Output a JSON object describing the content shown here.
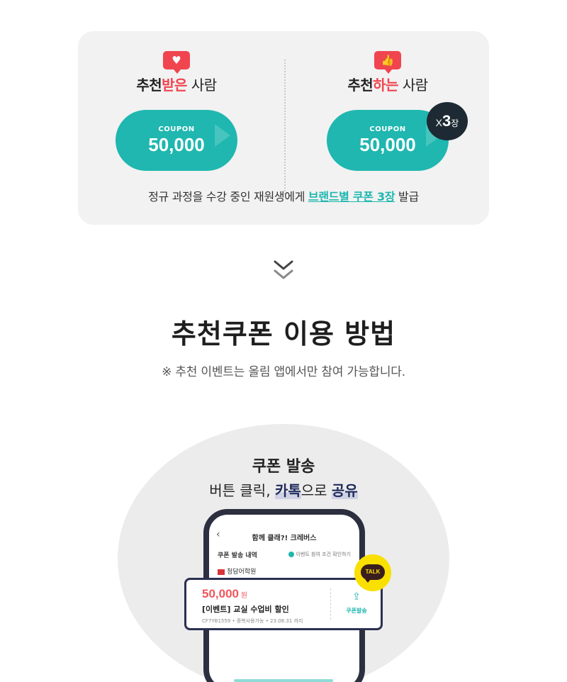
{
  "card": {
    "left": {
      "badge_icon": "heart-icon",
      "badge_glyph": "♥",
      "title_part1": "추천",
      "title_highlight": "받은",
      "title_part2": " 사람",
      "coupon_label": "COUPON",
      "coupon_amount": "50,000"
    },
    "right": {
      "badge_icon": "thumbs-up-icon",
      "badge_glyph": "👍",
      "title_part1": "추천",
      "title_highlight": "하는",
      "title_part2": " 사람",
      "coupon_label": "COUPON",
      "coupon_amount": "50,000",
      "multiplier_x": "X",
      "multiplier_n": "3",
      "multiplier_unit": "장"
    },
    "note_prefix": "정규 과정을 수강 중인 재원생에게 ",
    "note_link": "브랜드별 쿠폰 3장",
    "note_suffix": " 발급"
  },
  "heading": "추천쿠폰 이용 방법",
  "notice": "※ 추천 이벤트는 올림 앱에서만 참여 가능합니다.",
  "illustration": {
    "title": "쿠폰 발송",
    "sub_prefix": "버튼 클릭, ",
    "sub_strong1": "카톡",
    "sub_mid": "으로 ",
    "sub_strong2": "공유",
    "phone": {
      "back_glyph": "‹",
      "header": "함께 클래?! 크레버스",
      "row_label": "쿠폰 발송 내역",
      "row_link": "이벤트 참여 조건 확인하기",
      "school": "청담어학원"
    },
    "coupon": {
      "amount": "50,000",
      "won": " 원",
      "event": "[이벤트] 교실 수업비 할인",
      "meta": "CF7YB1559 • 중복사용가능 • 23.08.31 까지",
      "send_glyph": "⇪",
      "send_label": "쿠폰발송"
    },
    "talk_label": "TALK"
  },
  "colors": {
    "accent_teal": "#1fb7b0",
    "accent_red": "#f0454f",
    "navy": "#2b2f52",
    "kakao_yellow": "#f9e000"
  }
}
